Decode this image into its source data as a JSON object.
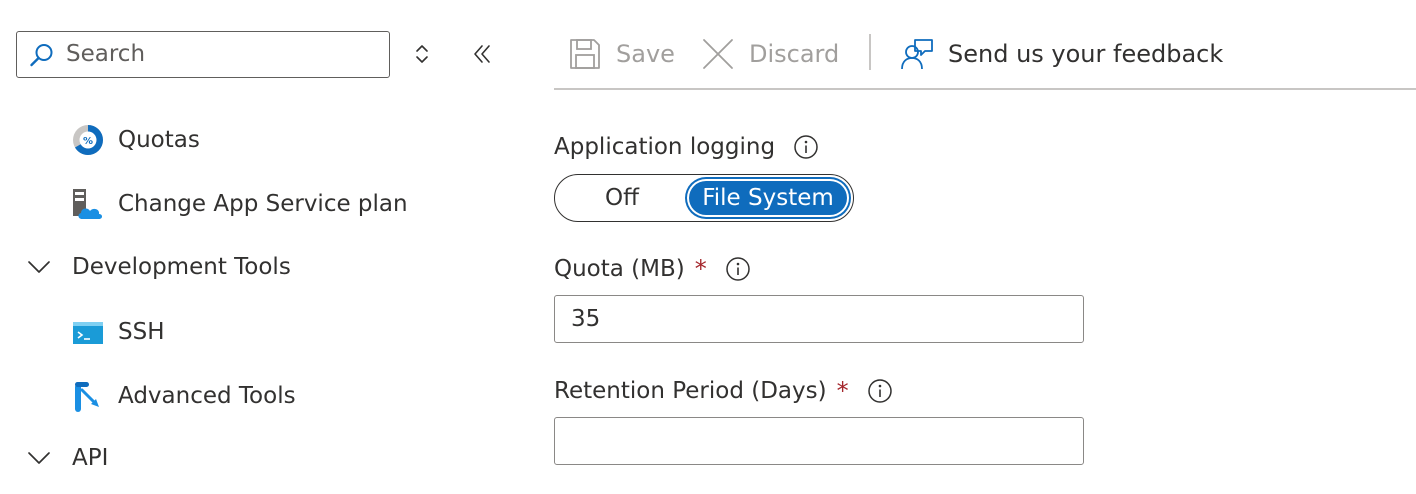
{
  "sidebar": {
    "search": {
      "placeholder": "Search",
      "value": ""
    },
    "items": [
      {
        "label": "Quotas",
        "icon": "quotas-icon"
      },
      {
        "label": "Change App Service plan",
        "icon": "app-service-plan-icon"
      },
      {
        "label": "Development Tools",
        "icon": "chevron-down-icon",
        "expanded": true
      },
      {
        "label": "SSH",
        "icon": "ssh-console-icon"
      },
      {
        "label": "Advanced Tools",
        "icon": "advanced-tools-icon"
      },
      {
        "label": "API",
        "icon": "chevron-down-icon",
        "expanded": true
      }
    ]
  },
  "toolbar": {
    "save_label": "Save",
    "discard_label": "Discard",
    "feedback_label": "Send us your feedback"
  },
  "form": {
    "app_logging": {
      "label": "Application logging",
      "options": [
        "Off",
        "File System"
      ],
      "selected": "File System"
    },
    "quota": {
      "label": "Quota (MB)",
      "required_mark": "*",
      "value": "35"
    },
    "retention": {
      "label": "Retention Period (Days)",
      "required_mark": "*",
      "value": ""
    }
  },
  "colors": {
    "accent": "#0f6cbd",
    "required": "#a4262c",
    "disabled_text": "#a19f9d",
    "text": "#323130"
  }
}
